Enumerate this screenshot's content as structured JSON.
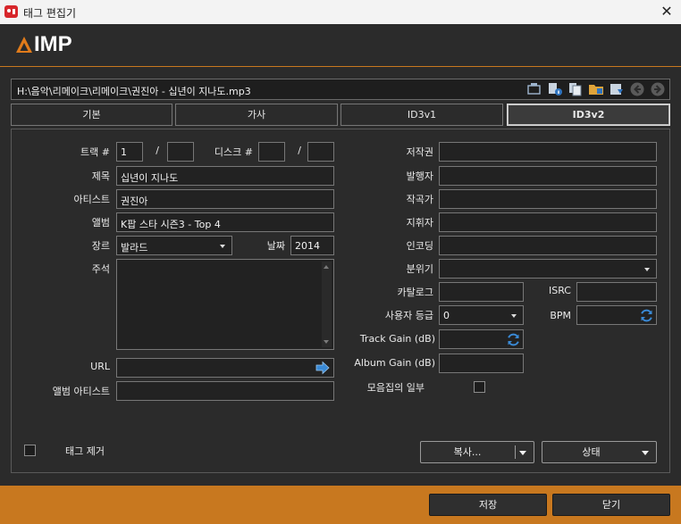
{
  "window": {
    "title": "태그 편집기",
    "close_glyph": "✕"
  },
  "brand": {
    "logo_text": "IMP",
    "accent": "#c8781f"
  },
  "file": {
    "path": "H:\\음악\\리메이크\\리메이크\\권진아 - 십년이 지나도.mp3"
  },
  "toolbar": {
    "icons": [
      "media-icon",
      "tag-info-icon",
      "copy-icon",
      "folder-icon",
      "save-icon",
      "prev-icon",
      "next-icon"
    ]
  },
  "tabs": [
    {
      "label": "기본",
      "active": false
    },
    {
      "label": "가사",
      "active": false
    },
    {
      "label": "ID3v1",
      "active": false
    },
    {
      "label": "ID3v2",
      "active": true
    }
  ],
  "fields": {
    "track_label": "트랙 #",
    "track_value": "1",
    "track_total": "",
    "slash": "/",
    "disc_label": "디스크 #",
    "disc_value": "",
    "disc_total": "",
    "title_label": "제목",
    "title_value": "십년이 지나도",
    "artist_label": "아티스트",
    "artist_value": "권진아",
    "album_label": "앨범",
    "album_value": "K팝 스타 시즌3 - Top 4",
    "genre_label": "장르",
    "genre_value": "발라드",
    "date_label": "날짜",
    "date_value": "2014",
    "comment_label": "주석",
    "comment_value": "",
    "url_label": "URL",
    "url_value": "",
    "album_artist_label": "앨범 아티스트",
    "album_artist_value": "",
    "copyright_label": "저작권",
    "publisher_label": "발행자",
    "composer_label": "작곡가",
    "conductor_label": "지휘자",
    "encoded_by_label": "인코딩",
    "mood_label": "분위기",
    "catalog_label": "카탈로그",
    "isrc_label": "ISRC",
    "rating_label": "사용자 등급",
    "rating_value": "0",
    "bpm_label": "BPM",
    "track_gain_label": "Track Gain (dB)",
    "album_gain_label": "Album Gain (dB)",
    "compilation_label": "모음집의 일부",
    "remove_tag_label": "태그 제거"
  },
  "buttons": {
    "copy": "복사...",
    "status": "상태",
    "save": "저장",
    "close": "닫기"
  }
}
